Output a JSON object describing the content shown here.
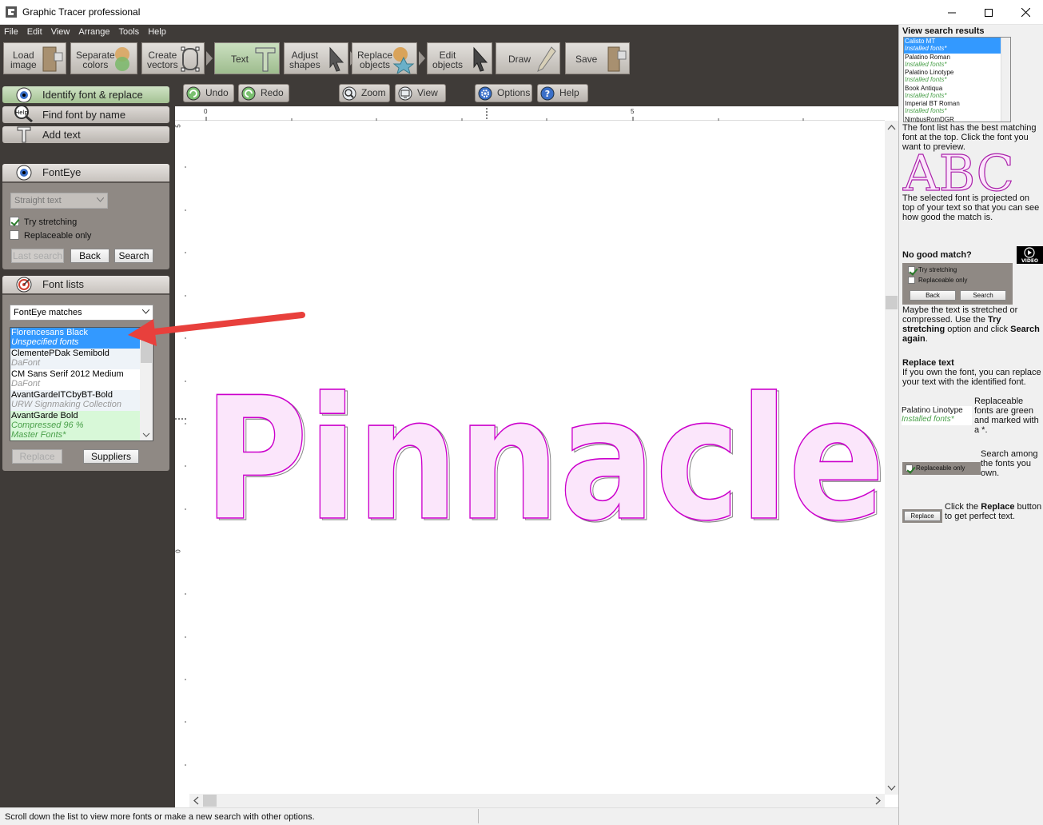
{
  "window": {
    "title": "Graphic Tracer professional"
  },
  "menu": [
    "File",
    "Edit",
    "View",
    "Arrange",
    "Tools",
    "Help"
  ],
  "toolbar": [
    {
      "line1": "Load",
      "line2": "image"
    },
    {
      "line1": "Separate",
      "line2": "colors"
    },
    {
      "line1": "Create",
      "line2": "vectors"
    },
    {
      "line1": "Text",
      "line2": ""
    },
    {
      "line1": "Adjust",
      "line2": "shapes"
    },
    {
      "line1": "Replace",
      "line2": "objects"
    },
    {
      "line1": "Edit",
      "line2": "objects"
    },
    {
      "line1": "Draw",
      "line2": ""
    },
    {
      "line1": "Save",
      "line2": ""
    }
  ],
  "toolbar2": {
    "undo": "Undo",
    "redo": "Redo",
    "zoom": "Zoom",
    "view": "View",
    "options": "Options",
    "help": "Help"
  },
  "modes": {
    "identify": "Identify font & replace",
    "find": "Find font by name",
    "find_icon_text": "Help",
    "add": "Add text"
  },
  "fonteye": {
    "title": "FontEye",
    "style_select": "Straight text",
    "try_stretching": "Try stretching",
    "try_stretching_checked": true,
    "replaceable_only": "Replaceable only",
    "replaceable_only_checked": false,
    "last_search": "Last search",
    "back": "Back",
    "search": "Search"
  },
  "fontlists": {
    "title": "Font lists",
    "select": "FontEye matches",
    "items": [
      {
        "name": "Florencesans Black",
        "source": "Unspecified fonts"
      },
      {
        "name": "ClementePDak Semibold",
        "source": "DaFont"
      },
      {
        "name": "CM Sans Serif 2012 Medium",
        "source": "DaFont"
      },
      {
        "name": "AvantGardeITCbyBT-Bold",
        "source": "URW Signmaking Collection"
      },
      {
        "name": "AvantGarde Bold",
        "source": "Compressed 96 %",
        "source2": "Master Fonts*"
      }
    ],
    "replace": "Replace",
    "suppliers": "Suppliers"
  },
  "canvas": {
    "word": "Pinnacle",
    "ruler_top": [
      "0",
      "5"
    ],
    "ruler_left": [
      "5",
      "0"
    ]
  },
  "status": {
    "text": "Scroll down the list to view more fonts or make a new search with other options."
  },
  "help": {
    "results_title": "View search results",
    "results": [
      {
        "name": "Calisto MT",
        "source": "Installed fonts*"
      },
      {
        "name": "Palatino Roman",
        "source": "Installed fonts*"
      },
      {
        "name": "Palatino Linotype",
        "source": "Installed fonts*"
      },
      {
        "name": "Book Antiqua",
        "source": "Installed fonts*"
      },
      {
        "name": "Imperial BT Roman",
        "source": "Installed fonts*"
      },
      {
        "name": "NimbusRomDGR",
        "source": ""
      }
    ],
    "p1": "The font list has the best matching font at the top. Click the font you want to preview.",
    "abc": "ABC",
    "p2": "The selected font is projected on top of your text so that you can see how good the match is.",
    "nogood_title": "No good match?",
    "video": "VIDEO",
    "mini_try": "Try stretching",
    "mini_repl": "Replaceable only",
    "mini_back": "Back",
    "mini_search": "Search",
    "p3a": "Maybe the text is stretched or compressed. Use the ",
    "p3b": "Try stretching",
    "p3c": " option and click ",
    "p3d": "Search again",
    "p3e": ".",
    "replace_title": "Replace text",
    "p4": "If you own the font, you can replace your text with the identified font.",
    "sample_name": "Palatino Linotype",
    "sample_source": "Installed fonts*",
    "p5": "Replaceable fonts are green and marked with a *.",
    "mini_repl2": "Replaceable only",
    "p6": "Search among the fonts you own.",
    "mini_replace": "Replace",
    "p7a": "Click the ",
    "p7b": "Replace",
    "p7c": " button to get perfect text."
  },
  "colors": {
    "accent_selection": "#3399ff",
    "panel_dark": "#3f3b38",
    "trace_magenta": "#cc00cc",
    "arrow_red": "#e8403c",
    "replaceable_green": "#4aa04a"
  }
}
